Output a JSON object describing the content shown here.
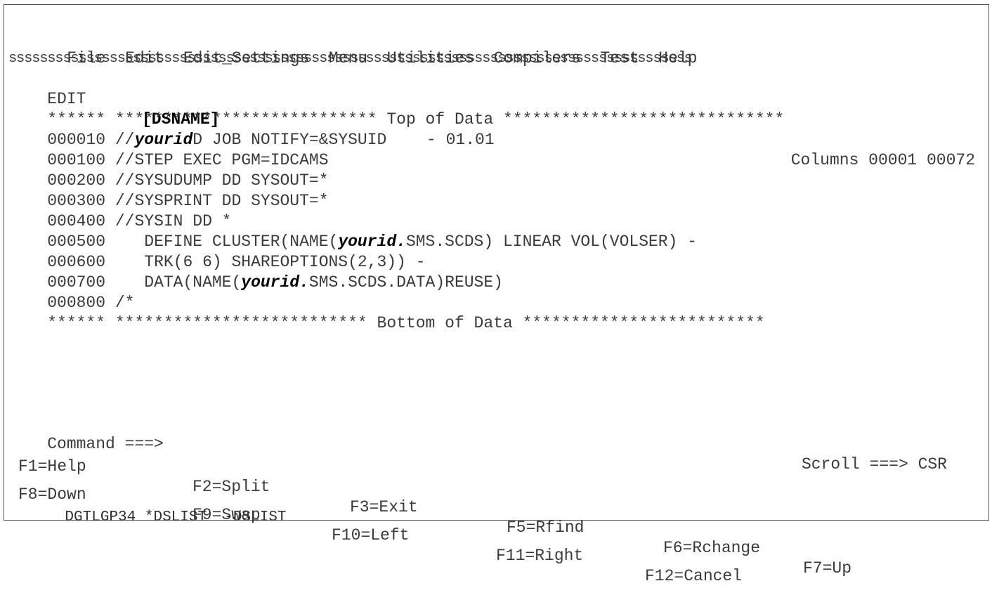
{
  "menu": {
    "items": [
      "File",
      "Edit",
      "Edit_Settings",
      "Menu",
      "Utilities",
      "Compilers",
      "Test",
      "Help"
    ]
  },
  "separator": "ssssssssssssssssssssssssssssssssssssssssssssssssssssssssssssssssssssssssssssssssssssssss",
  "header": {
    "mode": "EDIT",
    "dsname": "[DSNAME]",
    "version": "- 01.01",
    "columns": "Columns 00001 00072"
  },
  "top_marker": {
    "prefix": "******",
    "left_stars": "***************************",
    "text": "Top of Data",
    "right_stars": "*****************************"
  },
  "source_lines": [
    {
      "num": "000010",
      "pre": "//",
      "bold": "yourid",
      "post": "D JOB NOTIFY=&SYSUID"
    },
    {
      "num": "000100",
      "pre": "//STEP EXEC PGM=IDCAMS",
      "bold": "",
      "post": ""
    },
    {
      "num": "000200",
      "pre": "//SYSUDUMP DD SYSOUT=*",
      "bold": "",
      "post": ""
    },
    {
      "num": "000300",
      "pre": "//SYSPRINT DD SYSOUT=*",
      "bold": "",
      "post": ""
    },
    {
      "num": "000400",
      "pre": "//SYSIN DD *",
      "bold": "",
      "post": ""
    },
    {
      "num": "000500",
      "pre": "   DEFINE CLUSTER(NAME(",
      "bold": "yourid.",
      "post": "SMS.SCDS) LINEAR VOL(VOLSER) -"
    },
    {
      "num": "000600",
      "pre": "   TRK(6 6) SHAREOPTIONS(2,3)) -",
      "bold": "",
      "post": ""
    },
    {
      "num": "000700",
      "pre": "   DATA(NAME(",
      "bold": "yourid.",
      "post": "SMS.SCDS.DATA)REUSE)"
    },
    {
      "num": "000800",
      "pre": "/*",
      "bold": "",
      "post": ""
    }
  ],
  "bottom_marker": {
    "prefix": "******",
    "left_stars": "**************************",
    "text": "Bottom of Data",
    "right_stars": "*************************"
  },
  "command": {
    "label": "Command ===>",
    "value": "",
    "scroll_label": "Scroll ===>",
    "scroll_value": "CSR"
  },
  "function_keys": {
    "row1": [
      "F1=Help",
      "F2=Split",
      "F3=Exit",
      "F5=Rfind",
      "F6=Rchange",
      "F7=Up"
    ],
    "row2": [
      "F8=Down",
      "F9=Swap",
      "F10=Left",
      "F11=Right",
      "F12=Cancel"
    ]
  },
  "status": {
    "terminal": "DGTLGP34",
    "session1": "*DSLIST",
    "session2": "-DSLIST"
  }
}
